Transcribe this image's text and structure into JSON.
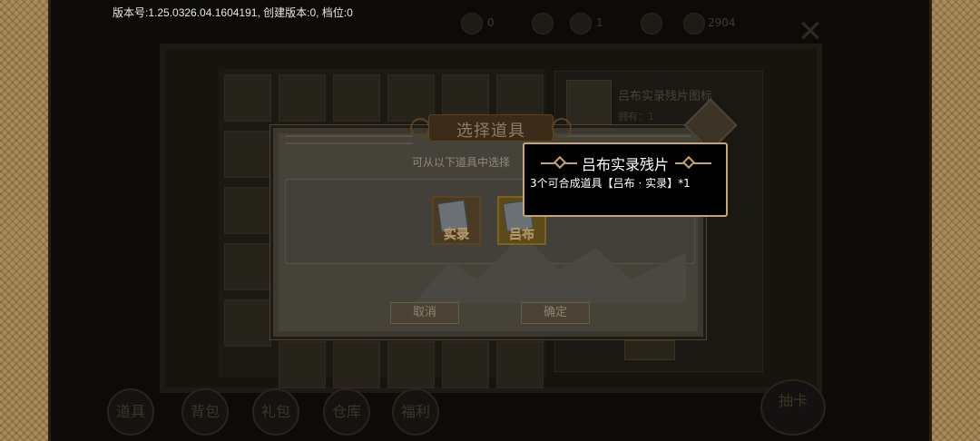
{
  "version_info": "版本号:1.25.0326.04.1604191, 创建版本:0, 档位:0",
  "background": {
    "status": [
      {
        "icon": "gem-icon",
        "value": "0"
      },
      {
        "icon": "coin-icon",
        "value": ""
      },
      {
        "icon": "box-icon",
        "value": "1"
      },
      {
        "icon": "token-icon",
        "value": ""
      },
      {
        "icon": "diamond-icon",
        "value": "2904"
      }
    ],
    "detail_title": "吕布实录残片图标",
    "detail_sub": "拥有：1",
    "bottom_tabs": [
      "道具",
      "背包",
      "礼包",
      "仓库",
      "福利"
    ],
    "gacha_label": "抽卡"
  },
  "dialog": {
    "title": "选择道具",
    "hint": "可从以下道具中选择",
    "items": [
      {
        "label": "实录",
        "icon": "document-icon"
      },
      {
        "label": "吕布",
        "icon": "document-icon"
      }
    ],
    "cancel_label": "取消",
    "confirm_label": "确定"
  },
  "tooltip": {
    "title": "吕布实录残片",
    "description": "3个可合成道具【吕布 · 实录】*1"
  },
  "colors": {
    "tooltip_border": "#c8a46a",
    "tooltip_bg": "#000000",
    "parchment": "#a88b5e"
  }
}
